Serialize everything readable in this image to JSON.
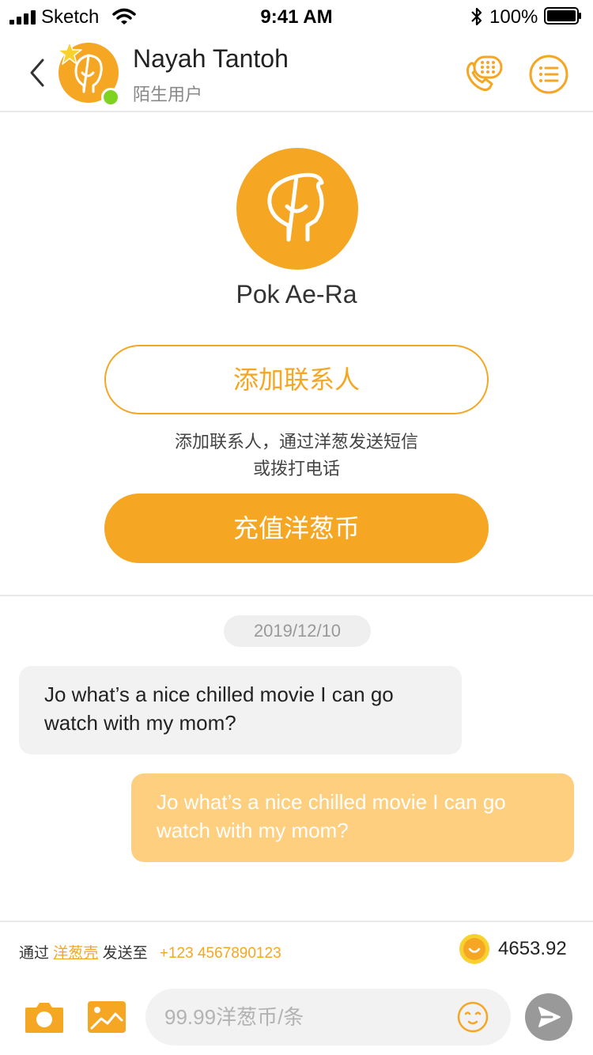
{
  "status_bar": {
    "carrier": "Sketch",
    "time": "9:41 AM",
    "battery": "100%"
  },
  "header": {
    "contact_name": "Nayah Tantoh",
    "contact_subtitle": "陌生用户",
    "icons": {
      "back": "chevron-left-icon",
      "call": "phone-dialpad-icon",
      "menu": "list-menu-icon"
    }
  },
  "profile": {
    "name": "Pok Ae-Ra",
    "add_contact_label": "添加联系人",
    "add_contact_hint_line1": "添加联系人，通过洋葱发送短信",
    "add_contact_hint_line2": "或拨打电话",
    "recharge_label": "充值洋葱币"
  },
  "chat": {
    "date": "2019/12/10",
    "messages": [
      {
        "direction": "incoming",
        "text": "Jo what’s a nice chilled movie I can go watch with my mom?"
      },
      {
        "direction": "outgoing",
        "text": "Jo what’s a nice chilled movie I can go watch with my mom?"
      }
    ]
  },
  "bottom_bar": {
    "via_prefix": "通过",
    "via_app": "洋葱壳",
    "send_to": "发送至",
    "phone_number": "+123 4567890123",
    "coin_balance": "4653.92",
    "input_placeholder": "99.99洋葱币/条"
  },
  "colors": {
    "accent": "#F5A623",
    "outgoing_bubble": "#FFCF80",
    "incoming_bubble": "#F2F2F2",
    "online": "#7ED321",
    "send_button": "#999999"
  }
}
